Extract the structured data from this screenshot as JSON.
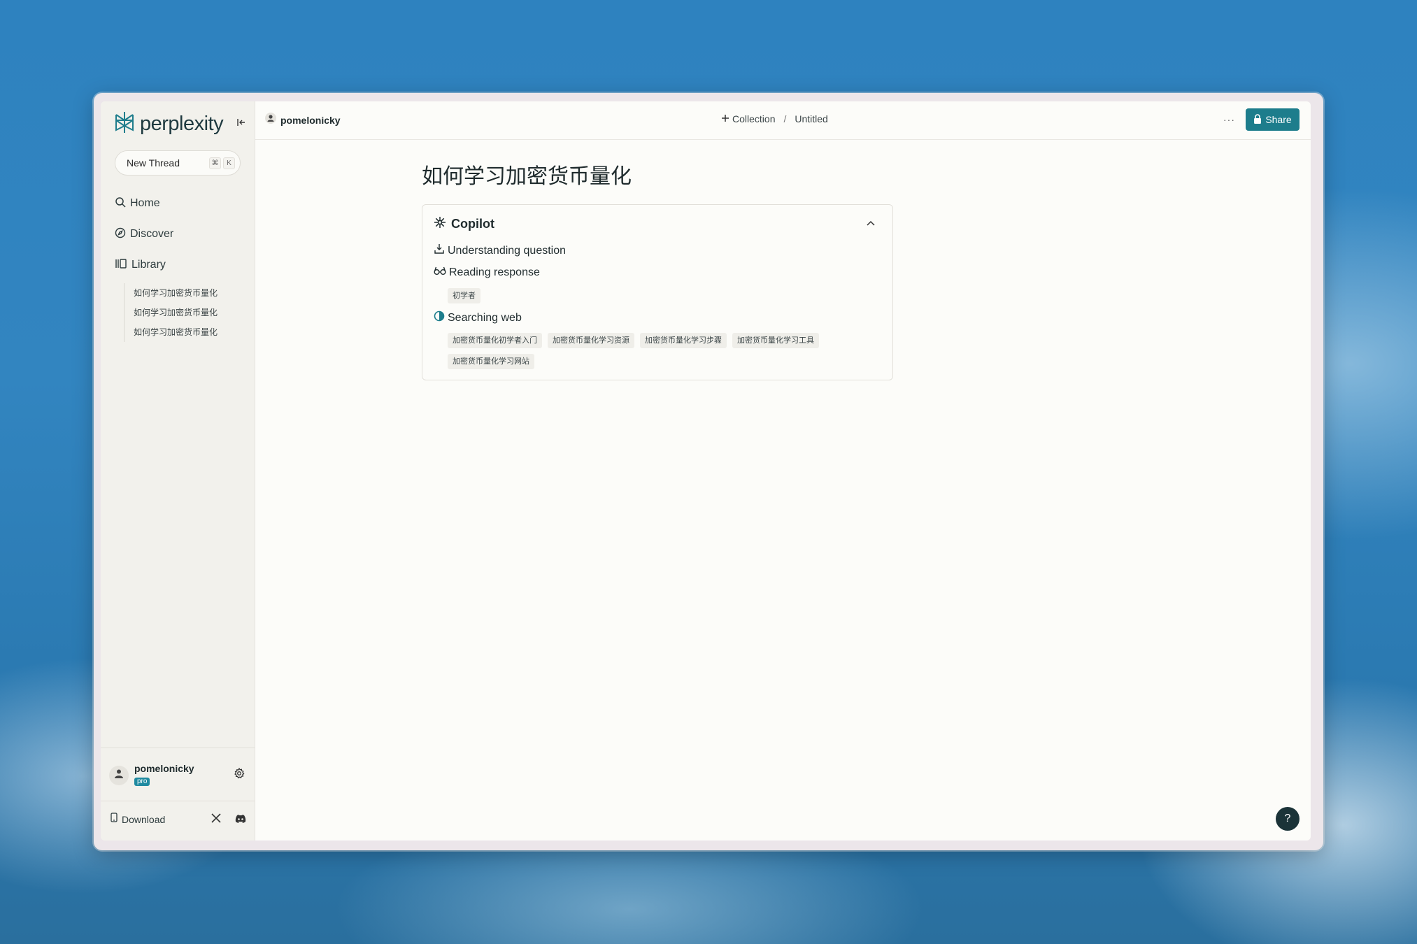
{
  "app": {
    "logo_text": "perplexity"
  },
  "sidebar": {
    "new_thread_label": "New Thread",
    "shortcut_keys": [
      "⌘",
      "K"
    ],
    "nav": [
      {
        "label": "Home",
        "icon": "search-icon"
      },
      {
        "label": "Discover",
        "icon": "compass-icon"
      },
      {
        "label": "Library",
        "icon": "library-icon"
      }
    ],
    "library_items": [
      "如何学习加密货币量化",
      "如何学习加密货币量化",
      "如何学习加密货币量化"
    ],
    "user": {
      "name": "pomelonicky",
      "badge": "pro"
    },
    "download_label": "Download"
  },
  "topbar": {
    "user_name": "pomelonicky",
    "collection_label": "Collection",
    "separator": "/",
    "page_name": "Untitled",
    "more_label": "···",
    "share_label": "Share"
  },
  "main": {
    "title": "如何学习加密货币量化",
    "copilot": {
      "title": "Copilot",
      "steps": [
        {
          "label": "Understanding question",
          "icon": "download-tray-icon"
        },
        {
          "label": "Reading response",
          "icon": "glasses-icon",
          "chips": [
            "初学者"
          ]
        },
        {
          "label": "Searching web",
          "icon": "spinner-icon",
          "chips": [
            "加密货币量化初学者入门",
            "加密货币量化学习资源",
            "加密货币量化学习步骤",
            "加密货币量化学习工具",
            "加密货币量化学习网站"
          ]
        }
      ]
    },
    "help_label": "?"
  },
  "colors": {
    "accent": "#1d7d8c",
    "pro_badge": "#1f8aa0",
    "help_bg": "#1b3338"
  }
}
